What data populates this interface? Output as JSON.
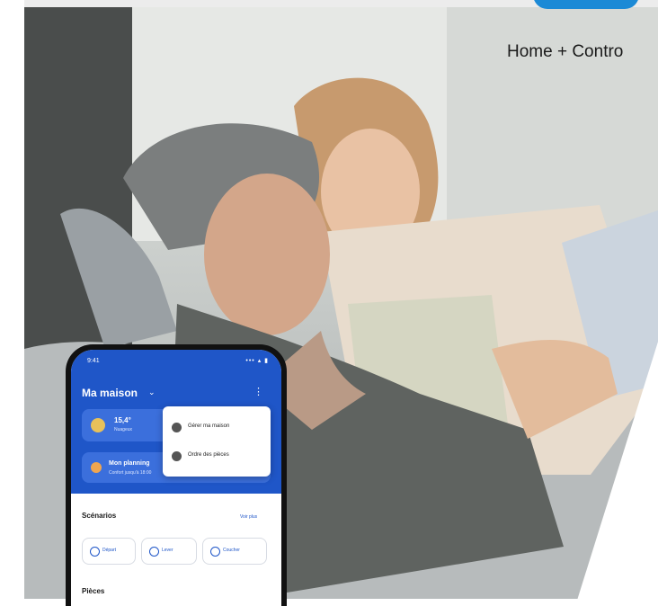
{
  "app": {
    "name": "Home + Contro",
    "brand_color": "#1c8ad6"
  },
  "phone": {
    "status": {
      "time": "9:41",
      "icons": "••• ▴ ▮"
    },
    "home": {
      "title": "Ma maison",
      "chevron": "⌄",
      "menu_icon": "⋮"
    },
    "weather": {
      "temp": "15,4°",
      "desc": "Nuageux"
    },
    "mode": {
      "title": "Mon planning",
      "subtitle": "Confort jusqu'à 18:00"
    },
    "menu": {
      "items": [
        {
          "label": "Gérer ma maison",
          "icon": "gear-icon"
        },
        {
          "label": "Ordre des pièces",
          "icon": "sort-icon"
        }
      ]
    },
    "scenarios": {
      "title": "Scénarios",
      "see_more": "Voir plus",
      "buttons": [
        {
          "label": "Départ",
          "icon": "departure-icon"
        },
        {
          "label": "Lever",
          "icon": "sunrise-icon"
        },
        {
          "label": "Coucher",
          "icon": "moon-icon"
        }
      ]
    },
    "rooms": {
      "title": "Pièces"
    },
    "accent": "#1f56c8"
  }
}
